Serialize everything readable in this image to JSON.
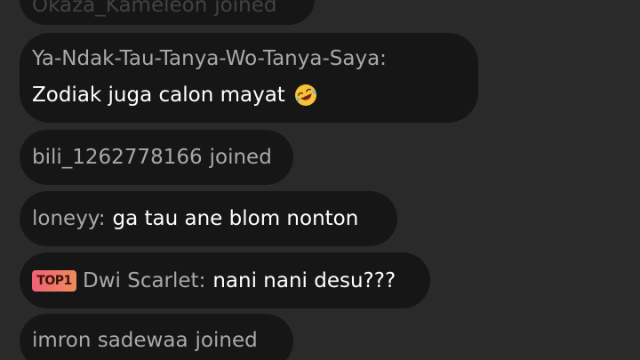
{
  "chat": {
    "messages": [
      {
        "type": "join",
        "user": "Okaza_Kameleon",
        "text": "joined"
      },
      {
        "type": "comment",
        "user": "Ya-Ndak-Tau-Tanya-Wo-Tanya-Saya:",
        "text": "Zodiak juga calon mayat",
        "emoji": "rolling-on-floor-laughing-emoji"
      },
      {
        "type": "join",
        "user": "bili_1262778166",
        "text": "joined"
      },
      {
        "type": "comment",
        "user": "loneyy:",
        "text": "ga tau ane blom nonton"
      },
      {
        "type": "comment",
        "badge": "TOP1",
        "user": "Dwi Scarlet:",
        "text": "nani nani desu???"
      },
      {
        "type": "join",
        "user": "imron sadewaa",
        "text": "joined"
      }
    ]
  },
  "colors": {
    "background": "#2a2a2a",
    "bubble": "#161616",
    "username": "#a9a9a9",
    "message": "#ffffff",
    "badge_gradient_start": "#f0607a",
    "badge_gradient_end": "#ef8c5a"
  }
}
